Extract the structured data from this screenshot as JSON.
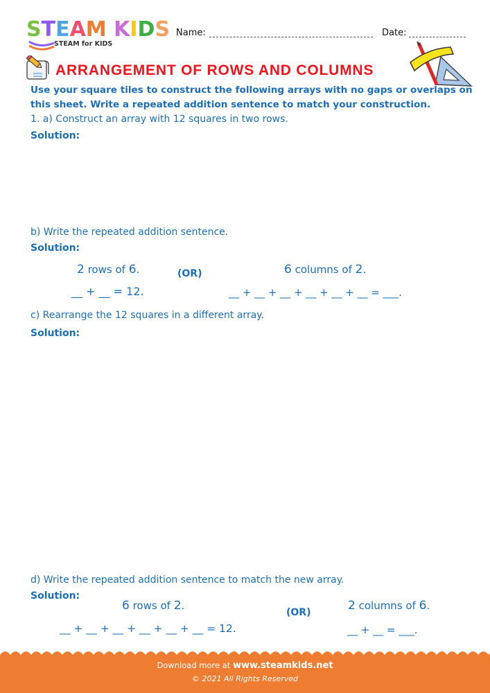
{
  "brand": {
    "logo_letters": [
      {
        "ch": "S",
        "color": "#7ac143"
      },
      {
        "ch": "T",
        "color": "#8b5cf6"
      },
      {
        "ch": "E",
        "color": "#4fa3e0"
      },
      {
        "ch": "A",
        "color": "#f0506e"
      },
      {
        "ch": "M",
        "color": "#ee7d31"
      },
      {
        "ch": " ",
        "color": "#ffffff"
      },
      {
        "ch": "K",
        "color": "#c86dd7"
      },
      {
        "ch": "I",
        "color": "#f5c518"
      },
      {
        "ch": "D",
        "color": "#3cb043"
      },
      {
        "ch": "S",
        "color": "#f4a261"
      }
    ],
    "tagline": "STEAM for KIDS"
  },
  "header": {
    "name_label": "Name:",
    "date_label": "Date:"
  },
  "title": "ARRANGEMENT OF ROWS AND COLUMNS",
  "icons": {
    "left": "pencil-scroll-icon",
    "right": "ruler-pencil-set-square-icon"
  },
  "instructions": "Use your square tiles to construct the following arrays with no gaps or overlaps on this sheet. Write a repeated addition sentence to match your construction.",
  "questions": {
    "a": {
      "text": "1.  a)  Construct an array with 12 squares in two rows.",
      "solution_label": "Solution:"
    },
    "b": {
      "text": "b)  Write the repeated addition sentence.",
      "solution_label": "Solution:",
      "left_caption_num1": "2",
      "left_caption_mid": " rows of ",
      "left_caption_num2": "6",
      "left_caption_end": ".",
      "left_equation": "__ + __ = 12.",
      "or_label": "(OR)",
      "right_caption_num1": "6",
      "right_caption_mid": " columns of ",
      "right_caption_num2": "2",
      "right_caption_end": ".",
      "right_equation": "__ + __ + __ + __ + __ + __ = ___."
    },
    "c": {
      "text": "c)  Rearrange the 12 squares in a different array.",
      "solution_label": "Solution:"
    },
    "d": {
      "text": "d)  Write the repeated addition sentence to match the new array.",
      "solution_label": "Solution:",
      "left_caption_num1": "6",
      "left_caption_mid": " rows of ",
      "left_caption_num2": "2",
      "left_caption_end": ".",
      "left_equation": "__ + __ + __ + __ + __ + __ = 12.",
      "or_label": "(OR)",
      "right_caption_num1": "2",
      "right_caption_mid": " columns of ",
      "right_caption_num2": "6",
      "right_caption_end": ".",
      "right_equation": "__ + __  = ___."
    }
  },
  "footer": {
    "download_prefix": "Download more at ",
    "site": "www.steamkids.net",
    "copyright": "© 2021 All Rights Reserved",
    "color": "#ee7d31"
  }
}
